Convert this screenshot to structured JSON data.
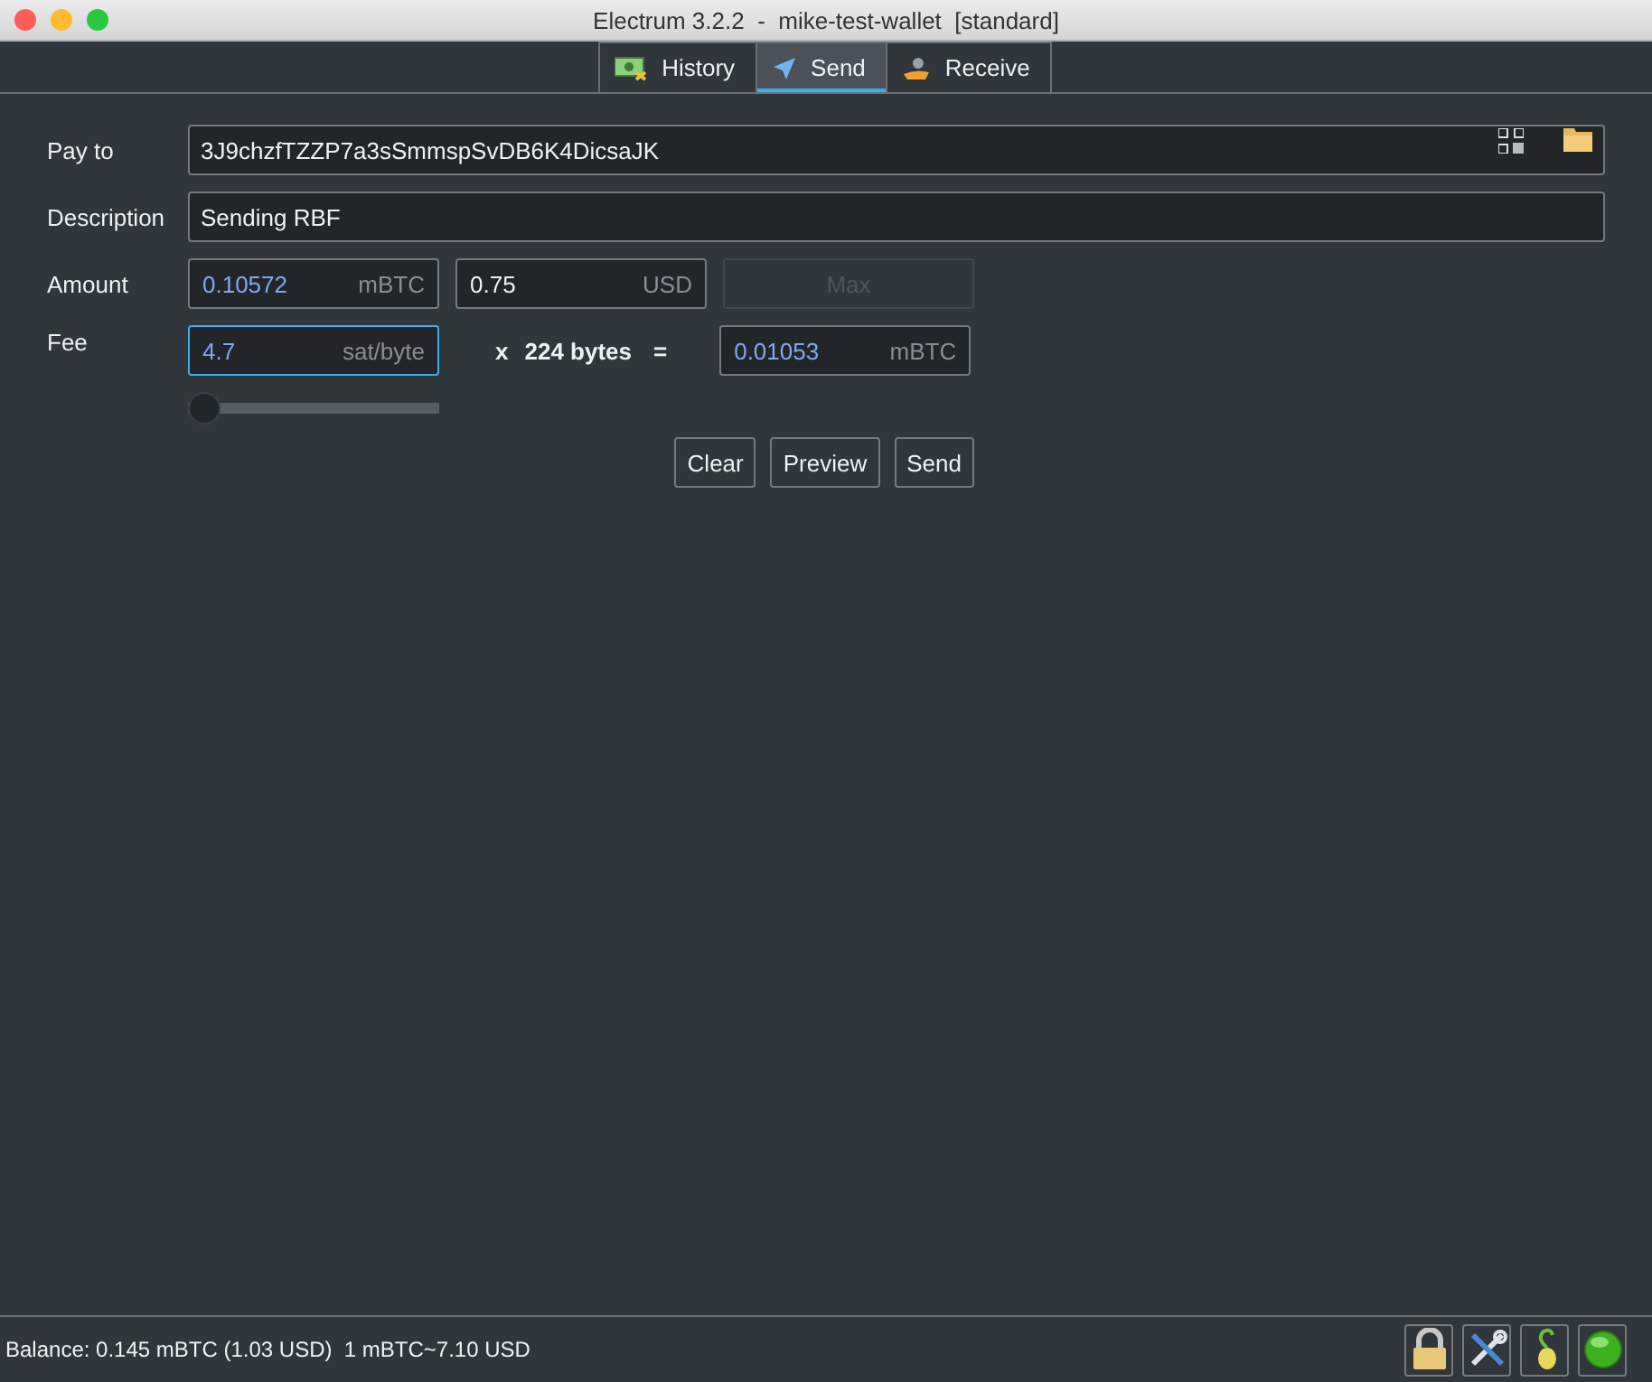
{
  "window": {
    "title": "Electrum 3.2.2  -  mike-test-wallet  [standard]"
  },
  "tabs": [
    {
      "label": "History",
      "selected": false
    },
    {
      "label": "Send",
      "selected": true
    },
    {
      "label": "Receive",
      "selected": false
    }
  ],
  "form": {
    "pay_to": {
      "label": "Pay to",
      "value": "3J9chzfTZZP7a3sSmmspSvDB6K4DicsaJK"
    },
    "description": {
      "label": "Description",
      "value": "Sending RBF"
    },
    "amount": {
      "label": "Amount",
      "fields": [
        {
          "value": "0.10572",
          "unit": "mBTC",
          "auto": true,
          "focused": false
        },
        {
          "value": "0.75",
          "unit": "USD",
          "auto": false,
          "focused": false
        }
      ],
      "max_button": {
        "label": "Max",
        "disabled": true
      }
    },
    "fee": {
      "label": "Fee",
      "rate": {
        "value": "4.7",
        "unit": "sat/byte",
        "auto": true,
        "focused": true
      },
      "times": "x",
      "size": "224 bytes",
      "equals": "=",
      "total": {
        "value": "0.01053",
        "unit": "mBTC",
        "auto": true,
        "focused": false
      },
      "slider": {
        "level": 0.0
      }
    },
    "buttons": [
      "Clear",
      "Preview",
      "Send"
    ]
  },
  "status_bar": {
    "balance": "Balance: 0.145 mBTC (1.03 USD)  1 mBTC~7.10 USD"
  }
}
